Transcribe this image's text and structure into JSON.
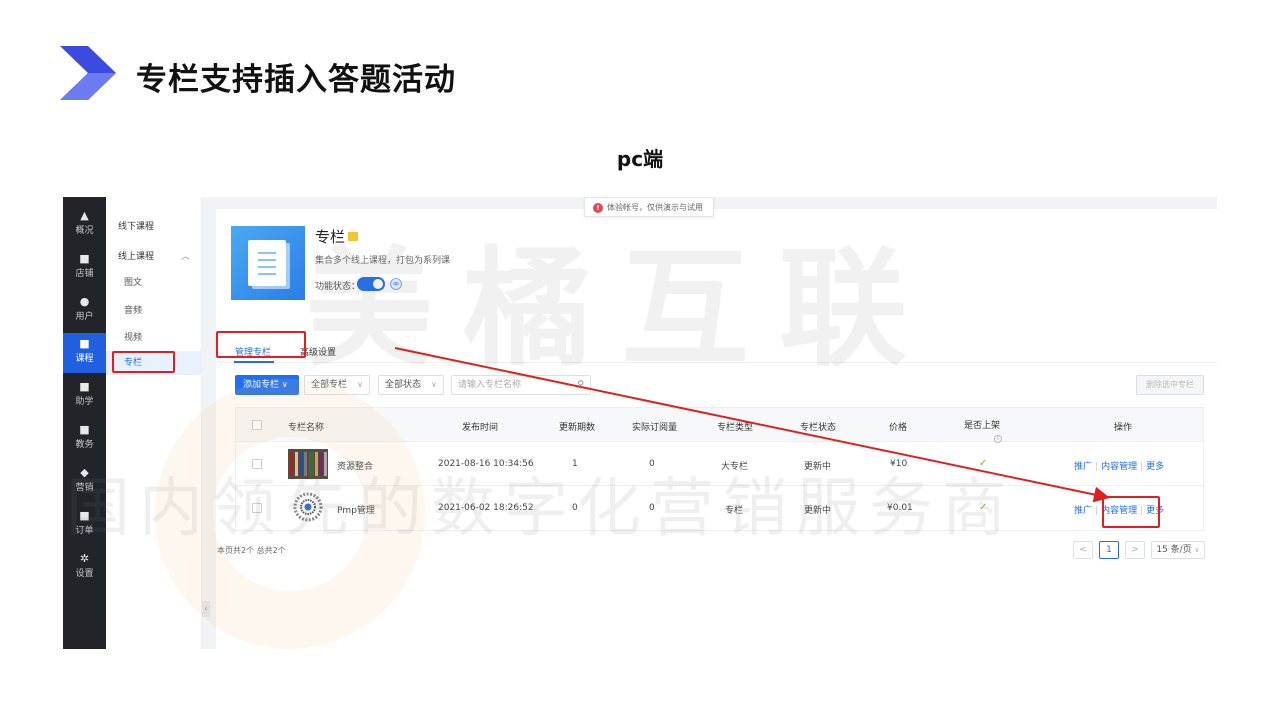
{
  "slide": {
    "title": "专栏支持插入答题活动",
    "subtitle": "pc端",
    "accent": "#3d4fe0"
  },
  "watermark": {
    "line1": "美橘互联",
    "line2": "国内领先的数字化营销服务商"
  },
  "nav": {
    "items": [
      {
        "icon": "chart-icon",
        "glyph": "▲",
        "label": "概况"
      },
      {
        "icon": "store-icon",
        "glyph": "■",
        "label": "店铺"
      },
      {
        "icon": "users-icon",
        "glyph": "●",
        "label": "用户"
      },
      {
        "icon": "course-icon",
        "glyph": "■",
        "label": "课程",
        "active": true
      },
      {
        "icon": "assist-icon",
        "glyph": "■",
        "label": "助学"
      },
      {
        "icon": "teach-icon",
        "glyph": "■",
        "label": "教务"
      },
      {
        "icon": "marketing-icon",
        "glyph": "◆",
        "label": "营销"
      },
      {
        "icon": "order-icon",
        "glyph": "■",
        "label": "订单"
      },
      {
        "icon": "settings-icon",
        "glyph": "✲",
        "label": "设置"
      }
    ]
  },
  "subnav": {
    "offline": "线下课程",
    "online": "线上课程",
    "children": [
      "图文",
      "音频",
      "视频",
      "专栏"
    ]
  },
  "toast": {
    "text": "体验帐号，仅供演示与试用",
    "icon": "error-icon"
  },
  "hero": {
    "title": "专栏",
    "desc": "集合多个线上课程，打包为系列课",
    "status_label": "功能状态：",
    "enabled": true
  },
  "tabs": [
    "管理专栏",
    "高级设置"
  ],
  "toolbar": {
    "add": "添加专栏",
    "filter_all_columns": "全部专栏",
    "filter_all_status": "全部状态",
    "search_placeholder": "请输入专栏名称",
    "delete_selected": "删除选中专栏"
  },
  "table": {
    "headers": [
      "专栏名称",
      "发布时间",
      "更新期数",
      "实际订阅量",
      "专栏类型",
      "专栏状态",
      "价格",
      "是否上架",
      "操作"
    ],
    "rows": [
      {
        "name": "资源整合",
        "published": "2021-08-16 10:34:56",
        "updates": "1",
        "subscribers": "0",
        "type": "大专栏",
        "status": "更新中",
        "price": "¥10",
        "listed": "✓",
        "actions": [
          "推广",
          "内容管理",
          "更多"
        ]
      },
      {
        "name": "Pmp管理",
        "published": "2021-06-02 18:26:52",
        "updates": "0",
        "subscribers": "0",
        "type": "专栏",
        "status": "更新中",
        "price": "¥0.01",
        "listed": "✓",
        "actions": [
          "推广",
          "内容管理",
          "更多"
        ]
      }
    ]
  },
  "pagination": {
    "summary": "本页共2个 总共2个",
    "prev": "<",
    "current": "1",
    "next": ">",
    "page_size": "15 条/页"
  }
}
